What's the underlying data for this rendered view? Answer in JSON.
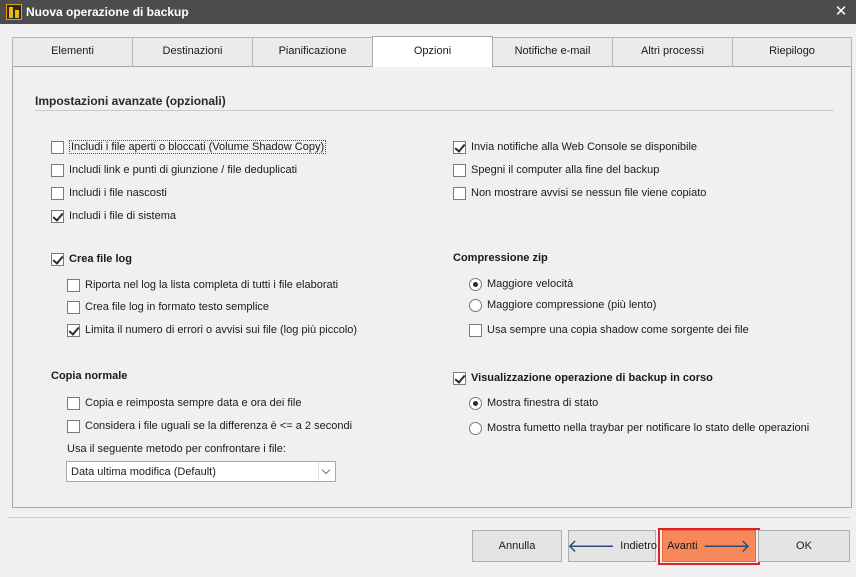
{
  "window": {
    "title": "Nuova operazione di backup",
    "close_glyph": "✕"
  },
  "tabs": [
    {
      "label": "Elementi"
    },
    {
      "label": "Destinazioni"
    },
    {
      "label": "Pianificazione"
    },
    {
      "label": "Opzioni",
      "active": true
    },
    {
      "label": "Notifiche e-mail"
    },
    {
      "label": "Altri processi"
    },
    {
      "label": "Riepilogo"
    }
  ],
  "advanced": {
    "title": "Impostazioni avanzate (opzionali)",
    "left_options": [
      {
        "label": "Includi i file aperti o bloccati (Volume Shadow Copy)",
        "checked": false
      },
      {
        "label": "Includi link e punti di giunzione / file deduplicati",
        "checked": false
      },
      {
        "label": "Includi i file nascosti",
        "checked": false
      },
      {
        "label": "Includi i file di sistema",
        "checked": true
      }
    ],
    "right_options": [
      {
        "label": "Invia notifiche alla Web Console se disponibile",
        "checked": true
      },
      {
        "label": "Spegni il computer alla fine del backup",
        "checked": false
      },
      {
        "label": "Non mostrare avvisi se nessun file viene copiato",
        "checked": false
      }
    ]
  },
  "log": {
    "label": "Crea file log",
    "checked": true,
    "options": [
      {
        "label": "Riporta nel log la lista completa di tutti i file elaborati",
        "checked": false
      },
      {
        "label": "Crea file log in formato testo semplice",
        "checked": false
      },
      {
        "label": "Limita il numero di errori o avvisi sui file (log più piccolo)",
        "checked": true
      }
    ]
  },
  "zip": {
    "title": "Compressione zip",
    "radios": [
      {
        "label": "Maggiore velocità",
        "selected": true
      },
      {
        "label": "Maggiore compressione (più lento)",
        "selected": false
      }
    ],
    "shadow": {
      "label": "Usa sempre una copia shadow come sorgente dei file",
      "checked": false
    }
  },
  "normal_copy": {
    "title": "Copia normale",
    "options": [
      {
        "label": "Copia e reimposta sempre data e ora dei file",
        "checked": false
      },
      {
        "label": "Considera i file uguali se la differenza è <= a 2 secondi",
        "checked": false
      }
    ],
    "method_label": "Usa il seguente metodo per confrontare i file:",
    "method_value": "Data ultima modifica (Default)"
  },
  "progress_view": {
    "label": "Visualizzazione operazione di backup in corso",
    "checked": true,
    "radios": [
      {
        "label": "Mostra finestra di stato",
        "selected": true
      },
      {
        "label": "Mostra fumetto nella traybar per notificare lo stato delle operazioni",
        "selected": false
      }
    ]
  },
  "buttons": {
    "cancel": "Annulla",
    "back": "Indietro",
    "next": "Avanti",
    "ok": "OK",
    "back_icon": "🡐",
    "next_icon": "🡒"
  },
  "colors": {
    "titlebar": "#4c4c4c",
    "primary_button": "#f6885a",
    "highlight": "#e11f2a"
  },
  "icons": {
    "app": "backup-app-icon",
    "close": "close-icon",
    "back": "arrow-left-icon",
    "next": "arrow-right-icon",
    "dropdown": "chevron-down-icon"
  }
}
